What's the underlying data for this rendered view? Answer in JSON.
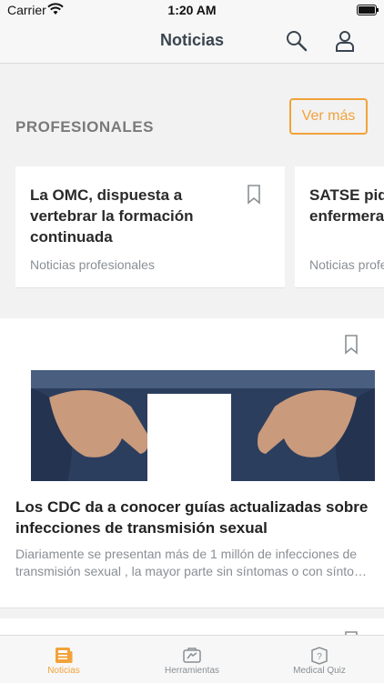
{
  "status_bar": {
    "carrier": "Carrier",
    "time": "1:20 AM"
  },
  "header": {
    "title": "Noticias"
  },
  "section": {
    "title": "PROFESIONALES",
    "more_label": "Ver más",
    "cards": [
      {
        "title": "La OMC, dispuesta a vertebrar la formación continuada",
        "category": "Noticias profesionales"
      },
      {
        "title": "SATSE pide la sobrecarga enfermera",
        "category": "Noticias profesionales"
      }
    ]
  },
  "feature": {
    "title": "Los CDC da a conocer guías actualizadas sobre infecciones de transmisión sexual",
    "desc_line1": "Diariamente se presentan más de 1 millón de infecciones de",
    "desc_line2": "transmisión sexual , la mayor parte sin síntomas o con síntomas leves"
  },
  "tabs": [
    {
      "label": "Noticias",
      "icon": "newspaper-icon",
      "active": true
    },
    {
      "label": "Herramientas",
      "icon": "toolbox-icon",
      "active": false
    },
    {
      "label": "Medical Quiz",
      "icon": "quiz-icon",
      "active": false
    }
  ],
  "colors": {
    "accent": "#f2a23a",
    "muted": "#8a8f94",
    "title": "#3a4550"
  }
}
